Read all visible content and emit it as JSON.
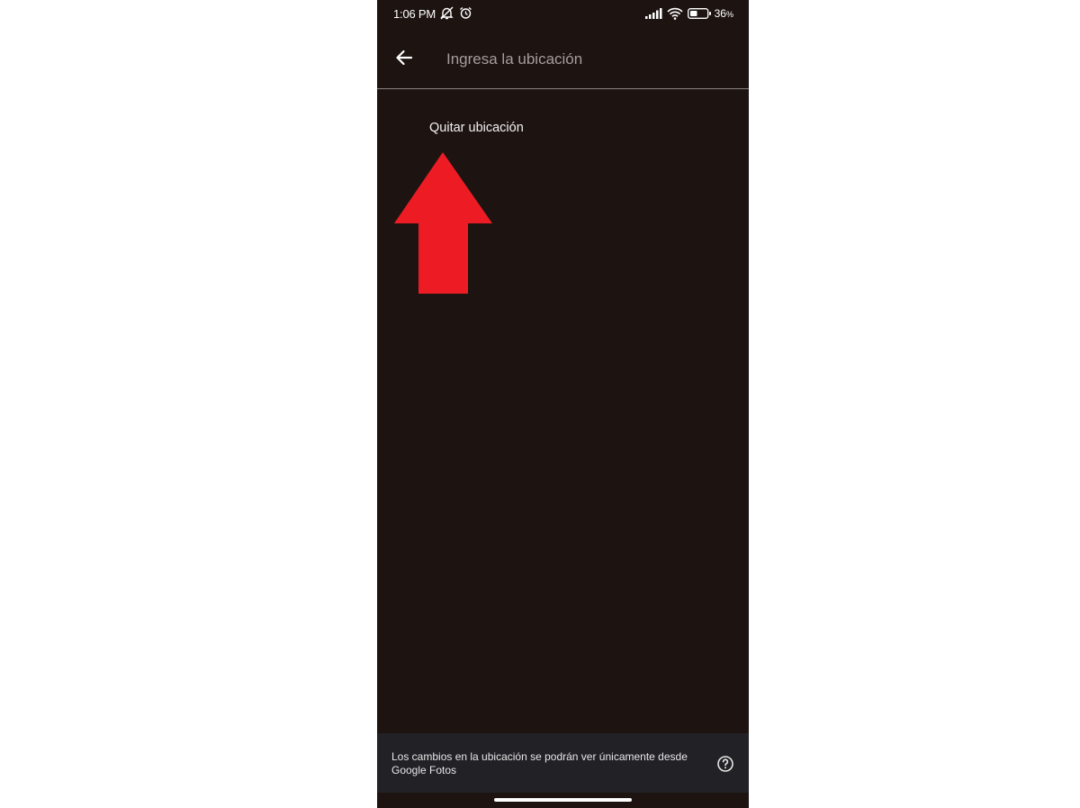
{
  "status_bar": {
    "time": "1:06 PM",
    "battery_percent": "36",
    "battery_percent_unit": "%",
    "icons": [
      "notifications-muted-icon",
      "alarm-icon",
      "signal-icon",
      "wifi-icon",
      "battery-icon"
    ]
  },
  "app_bar": {
    "back_icon": "arrow-left-icon",
    "search_placeholder": "Ingresa la ubicación",
    "search_value": ""
  },
  "content": {
    "remove_location_label": "Quitar ubicación",
    "annotation": {
      "icon": "red-up-arrow",
      "color": "#ed1c24"
    }
  },
  "info_bar": {
    "message": "Los cambios en la ubicación se podrán ver únicamente desde Google Fotos",
    "help_icon": "help-circle-icon"
  },
  "colors": {
    "background": "#1d1412",
    "info_bar": "#222125",
    "accent_arrow": "#ed1c24"
  }
}
